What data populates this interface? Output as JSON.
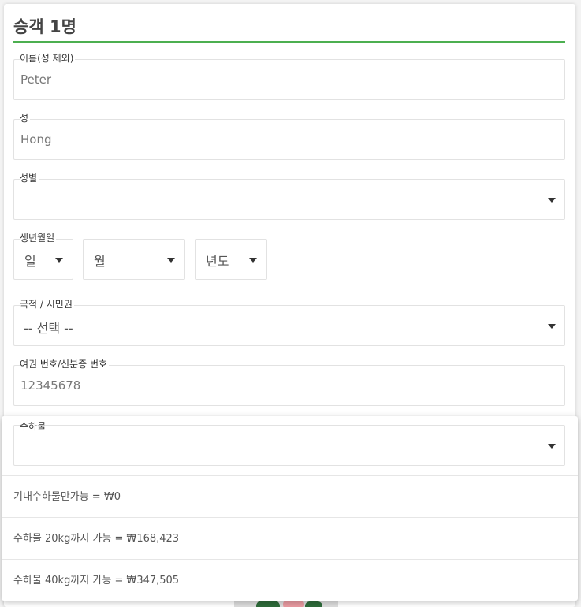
{
  "passenger": {
    "title": "승객 1명"
  },
  "first_name": {
    "label": "이름(성 제외)",
    "value": "Peter"
  },
  "last_name": {
    "label": "성",
    "value": "Hong"
  },
  "gender": {
    "label": "성별",
    "value": ""
  },
  "dob": {
    "label": "생년월일",
    "day": "일",
    "month": "월",
    "year": "년도"
  },
  "nationality": {
    "label": "국적 / 시민권",
    "value": "-- 선택 --"
  },
  "passport": {
    "label": "여권 번호/신분증 번호",
    "value": "12345678"
  },
  "baggage": {
    "label": "수하물",
    "value": "",
    "options": [
      "기내수하물만가능 = ₩0",
      "수하물 20kg까지 가능 = ₩168,423",
      "수하물 40kg까지 가능 = ₩347,505"
    ]
  },
  "colors": {
    "accent": "#4caf50"
  }
}
